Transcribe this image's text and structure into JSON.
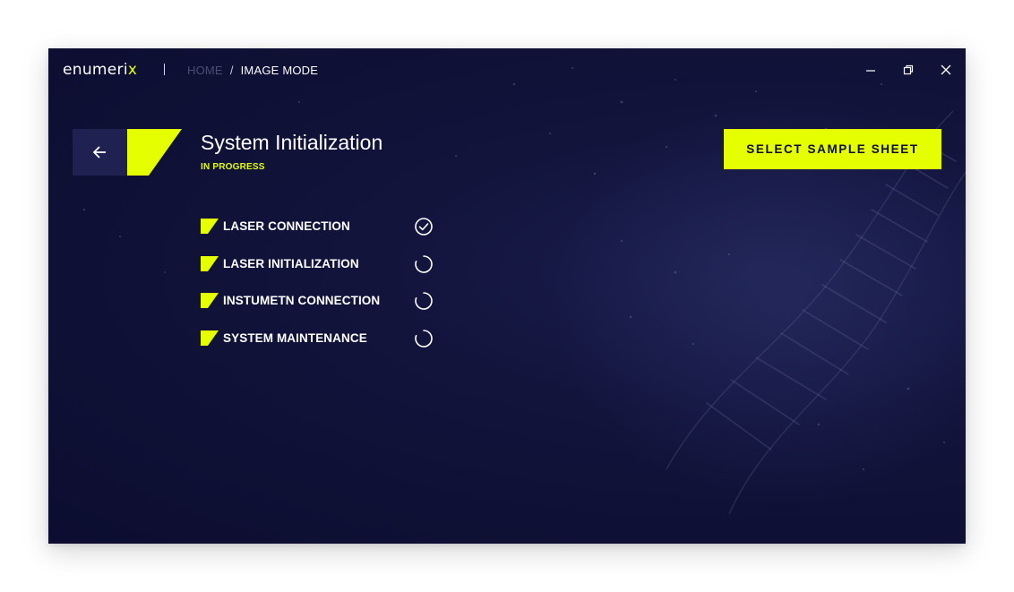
{
  "app": {
    "logo_main": "enumeri",
    "logo_accent": "x",
    "accent_color": "#e5ff00",
    "background_color": "#0e1035"
  },
  "breadcrumb": {
    "home": "HOME",
    "separator": "/",
    "current": "IMAGE MODE"
  },
  "window_controls": {
    "minimize_icon": "minimize-icon",
    "restore_icon": "restore-icon",
    "close_icon": "close-icon"
  },
  "header": {
    "back_icon": "arrow-left-icon",
    "title": "System Initialization",
    "status": "IN PROGRESS"
  },
  "actions": {
    "select_sample_sheet": "SELECT SAMPLE SHEET"
  },
  "steps": [
    {
      "label": "LASER CONNECTION",
      "state": "complete",
      "icon": "check-circle-icon"
    },
    {
      "label": "LASER INITIALIZATION",
      "state": "loading",
      "icon": "spinner-icon"
    },
    {
      "label": "INSTUMETN CONNECTION",
      "state": "loading",
      "icon": "spinner-icon"
    },
    {
      "label": "SYSTEM MAINTENANCE",
      "state": "loading",
      "icon": "spinner-icon"
    }
  ]
}
